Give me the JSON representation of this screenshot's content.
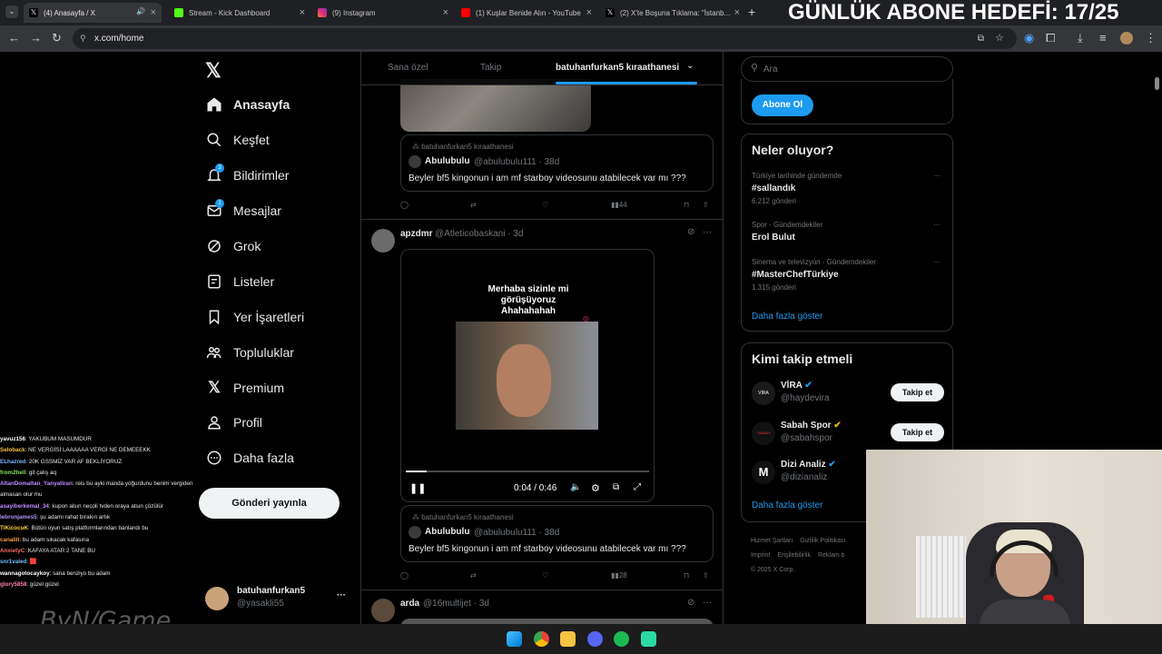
{
  "browser": {
    "tabs": [
      {
        "title": "(4) Anasayfa / X",
        "active": true
      },
      {
        "title": "Stream - Kick Dashboard"
      },
      {
        "title": "(9) Instagram"
      },
      {
        "title": "(1) Kuşlar Benide Alın - YouTube"
      },
      {
        "title": "(2) X'te Boşuna Tıklama: \"İstanb..."
      }
    ],
    "new_tab": "+",
    "url": "x.com/home"
  },
  "overlay": {
    "goal_text": "GÜNLÜK ABONE HEDEFİ: 17/25",
    "watermark": "ByN/Game"
  },
  "sidebar": {
    "logo": "x-logo-icon",
    "items": [
      {
        "label": "Anasayfa",
        "icon": "home-icon"
      },
      {
        "label": "Keşfet",
        "icon": "search-icon"
      },
      {
        "label": "Bildirimler",
        "icon": "bell-icon",
        "badge": "3"
      },
      {
        "label": "Mesajlar",
        "icon": "mail-icon",
        "badge": "1"
      },
      {
        "label": "Grok",
        "icon": "grok-icon"
      },
      {
        "label": "Listeler",
        "icon": "list-icon"
      },
      {
        "label": "Yer İşaretleri",
        "icon": "bookmark-icon"
      },
      {
        "label": "Topluluklar",
        "icon": "communities-icon"
      },
      {
        "label": "Premium",
        "icon": "x-premium-icon"
      },
      {
        "label": "Profil",
        "icon": "profile-icon"
      },
      {
        "label": "Daha fazla",
        "icon": "more-circle-icon"
      }
    ],
    "post_button": "Gönderi yayınla",
    "account": {
      "name": "batuhanfurkan5",
      "handle": "@yasakli55",
      "more": "···"
    }
  },
  "timeline": {
    "tabs": [
      "Sana özel",
      "Takip",
      "batuhanfurkan5 kıraathanesi"
    ],
    "post1": {
      "quote_community": "batuhanfurkan5 kıraathanesi",
      "quote_name": "Abulubulu",
      "quote_handle": "@abulubulu111",
      "quote_time": "· 38d",
      "quote_text": "Beyler bf5 kingonun i am mf starboy videosunu atabilecek var mı ???",
      "views": "44"
    },
    "post2": {
      "name": "apzdmr",
      "handle": "@Atleticobaskani",
      "time": "· 3d",
      "video_caption": "Merhaba sizinle mi görüşüyoruz Ahahahahah",
      "video_time": "0:04 / 0:46",
      "video_progress": 0.087,
      "quote_community": "batuhanfurkan5 kıraathanesi",
      "quote_name": "Abulubulu",
      "quote_handle": "@abulubulu111",
      "quote_time": "· 38d",
      "quote_text": "Beyler bf5 kingonun i am mf starboy videosunu atabilecek var mı ???",
      "views": "28"
    },
    "post3": {
      "name": "arda",
      "handle": "@16multijet",
      "time": "· 3d"
    }
  },
  "right": {
    "search_placeholder": "Ara",
    "subscribe_button": "Abone Ol",
    "trends_title": "Neler oluyor?",
    "trends": [
      {
        "context": "Türkiye tarihinde gündemde",
        "name": "#sallandık",
        "count": "6.212 gönderi"
      },
      {
        "context": "Spor · Gündemdekiler",
        "name": "Erol Bulut",
        "count": ""
      },
      {
        "context": "Sinema ve televizyon · Gündemdekiler",
        "name": "#MasterChefTürkiye",
        "count": "1.315 gönderi"
      }
    ],
    "trends_more": "Daha fazla göster",
    "who_title": "Kimi takip etmeli",
    "who": [
      {
        "name": "VİRA",
        "handle": "@haydevira",
        "button": "Takip et"
      },
      {
        "name": "Sabah Spor",
        "handle": "@sabahspor",
        "button": "Takip et"
      },
      {
        "name": "Dizi Analiz",
        "handle": "@dizianaliz",
        "button": ""
      }
    ],
    "who_more": "Daha fazla göster",
    "footer": [
      "Hizmet Şartları",
      "Gizlilik Politikası",
      "Imprint",
      "Erişilebilirlik",
      "Reklam b",
      "© 2025 X Corp."
    ]
  },
  "chat": [
    {
      "user": "yavuz156",
      "msg": ": YAKUBUM MASUMDUR",
      "color": "#ffffff"
    },
    {
      "user": "Seloback",
      "msg": ": NE VERGİSİ LAAAAAA VERGİ NE DEMEEEKK",
      "color": "#f5c542"
    },
    {
      "user": "ELhazred",
      "msg": ": 20K GSSMİZ VAR AF BEKLİYORUZ",
      "color": "#7ab8ff"
    },
    {
      "user": "from2hell",
      "msg": ": git çalış aq",
      "color": "#86e35c"
    },
    {
      "user": "AltanDomaltan_Yanyatiran",
      "msg": ": reis bu ayki manda yoğurdunu benim vergiden",
      "color": "#c08bff"
    },
    {
      "user": "",
      "msg": "almasan olur mu",
      "color": "#ffffff"
    },
    {
      "user": "asayiberkemal_34",
      "msg": ": kupon alsın necoli tvden oraya atsın çözülür",
      "color": "#c08bff"
    },
    {
      "user": "lebronjames5",
      "msg": ": şu adamı rahat bırakın artık",
      "color": "#b197fc"
    },
    {
      "user": "TiKicocuK",
      "msg": ": Bütün oyun satış platformlarından banlandı bu",
      "color": "#ffd43b"
    },
    {
      "user": "canalili",
      "msg": ": bu adam sıkacak kafasına",
      "color": "#ff9f43"
    },
    {
      "user": "AnxietyC",
      "msg": ": KAFAYA ATAR 2 TANE BU",
      "color": "#ff6b6b"
    },
    {
      "user": "snr1valed",
      "msg": ": 🟥",
      "color": "#74c0fc"
    },
    {
      "user": "wannagotocaykoy",
      "msg": ": sana benziyo bu adam",
      "color": "#ffffff"
    },
    {
      "user": "glory5858",
      "msg": ": güzel güzel",
      "color": "#f783ac"
    }
  ]
}
